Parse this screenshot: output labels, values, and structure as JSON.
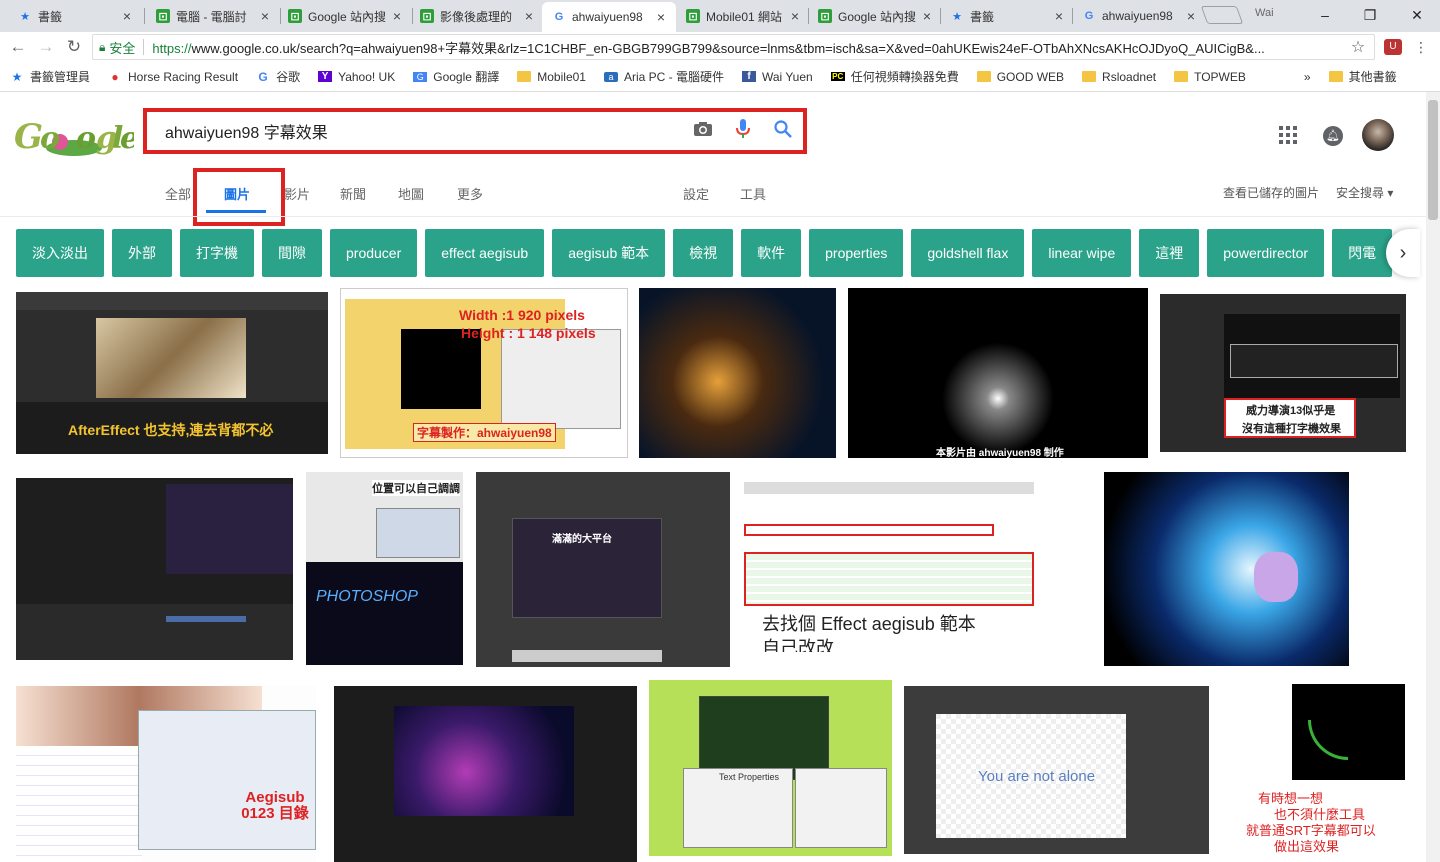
{
  "tabs": [
    {
      "title": "書籤",
      "icon": "bookmark-star-icon"
    },
    {
      "title": "電腦 - 電腦討",
      "icon": "mobile01-icon"
    },
    {
      "title": "Google 站內搜",
      "icon": "mobile01-icon"
    },
    {
      "title": "影像後處理的",
      "icon": "mobile01-icon"
    },
    {
      "title": "ahwaiyuen98",
      "icon": "google-icon"
    },
    {
      "title": "Mobile01 網站",
      "icon": "mobile01-icon"
    },
    {
      "title": "Google 站內搜",
      "icon": "mobile01-icon"
    },
    {
      "title": "書籤",
      "icon": "bookmark-star-icon"
    },
    {
      "title": "ahwaiyuen98",
      "icon": "google-icon"
    }
  ],
  "window": {
    "user": "Wai"
  },
  "omnibox": {
    "secure": "安全",
    "scheme": "https://",
    "url": "www.google.co.uk/search?q=ahwaiyuen98+字幕效果&rlz=1C1CHBF_en-GBGB799GB799&source=lnms&tbm=isch&sa=X&ved=0ahUKEwis24eF-OTbAhXNcsAKHcOJDyoQ_AUICigB&..."
  },
  "bookmarks": [
    {
      "label": "書籤管理員",
      "icon": "star-icon"
    },
    {
      "label": "Horse Racing Result",
      "icon": "location-pin-icon"
    },
    {
      "label": "谷歌",
      "icon": "google-icon"
    },
    {
      "label": "Yahoo! UK",
      "icon": "yahoo-icon"
    },
    {
      "label": "Google 翻譯",
      "icon": "translate-icon"
    },
    {
      "label": "Mobile01",
      "icon": "folder-icon"
    },
    {
      "label": "Aria PC - 電腦硬件",
      "icon": "aria-icon"
    },
    {
      "label": "Wai Yuen",
      "icon": "facebook-icon"
    },
    {
      "label": "任何視頻轉換器免費",
      "icon": "pc-icon"
    },
    {
      "label": "GOOD WEB",
      "icon": "folder-icon"
    },
    {
      "label": "Rsloadnet",
      "icon": "folder-icon"
    },
    {
      "label": "TOPWEB",
      "icon": "folder-icon"
    }
  ],
  "bookmarks_more": "»",
  "bookmarks_other": "其他書籤",
  "search": {
    "query": "ahwaiyuen98 字幕效果"
  },
  "nav": {
    "all": "全部",
    "images": "圖片",
    "videos": "影片",
    "news": "新聞",
    "maps": "地圖",
    "more": "更多",
    "settings": "設定",
    "tools": "工具",
    "saved": "查看已儲存的圖片",
    "safesearch": "安全搜尋"
  },
  "chips": [
    "淡入淡出",
    "外部",
    "打字機",
    "間隙",
    "producer",
    "effect aegisub",
    "aegisub 範本",
    "檢視",
    "軟件",
    "properties",
    "goldshell flax",
    "linear wipe",
    "這裡",
    "powerdirector",
    "閃電"
  ],
  "captions": {
    "c1": "AfterEffect 也支持,連去背都不必",
    "c2a": "Width :1 920 pixels",
    "c2b": "Height : 1 148 pixels",
    "c2c": "字幕製作：ahwaiyuen98",
    "c4": "本影片由 ahwaiyuen98 制作",
    "c5a": "威力導演13似乎是",
    "c5b": "沒有這種打字機效果",
    "c7": "位置可以自己調調",
    "c8": "滿滿的大平台",
    "c9a": "去找個 Effect aegisub 範本",
    "c9b": "自己改改..",
    "c11": "Aegisub 0123 目錄",
    "c14": "You are not alone",
    "c15a": "有時想一想",
    "c15b": "也不須什麼工具",
    "c15c": "就普通SRT字幕都可以",
    "c15d": "做出這效果",
    "c13": "Text Properties"
  },
  "colors": {
    "chip": "#2ba38a",
    "highlight": "#dd2222",
    "link": "#1a73e8"
  }
}
